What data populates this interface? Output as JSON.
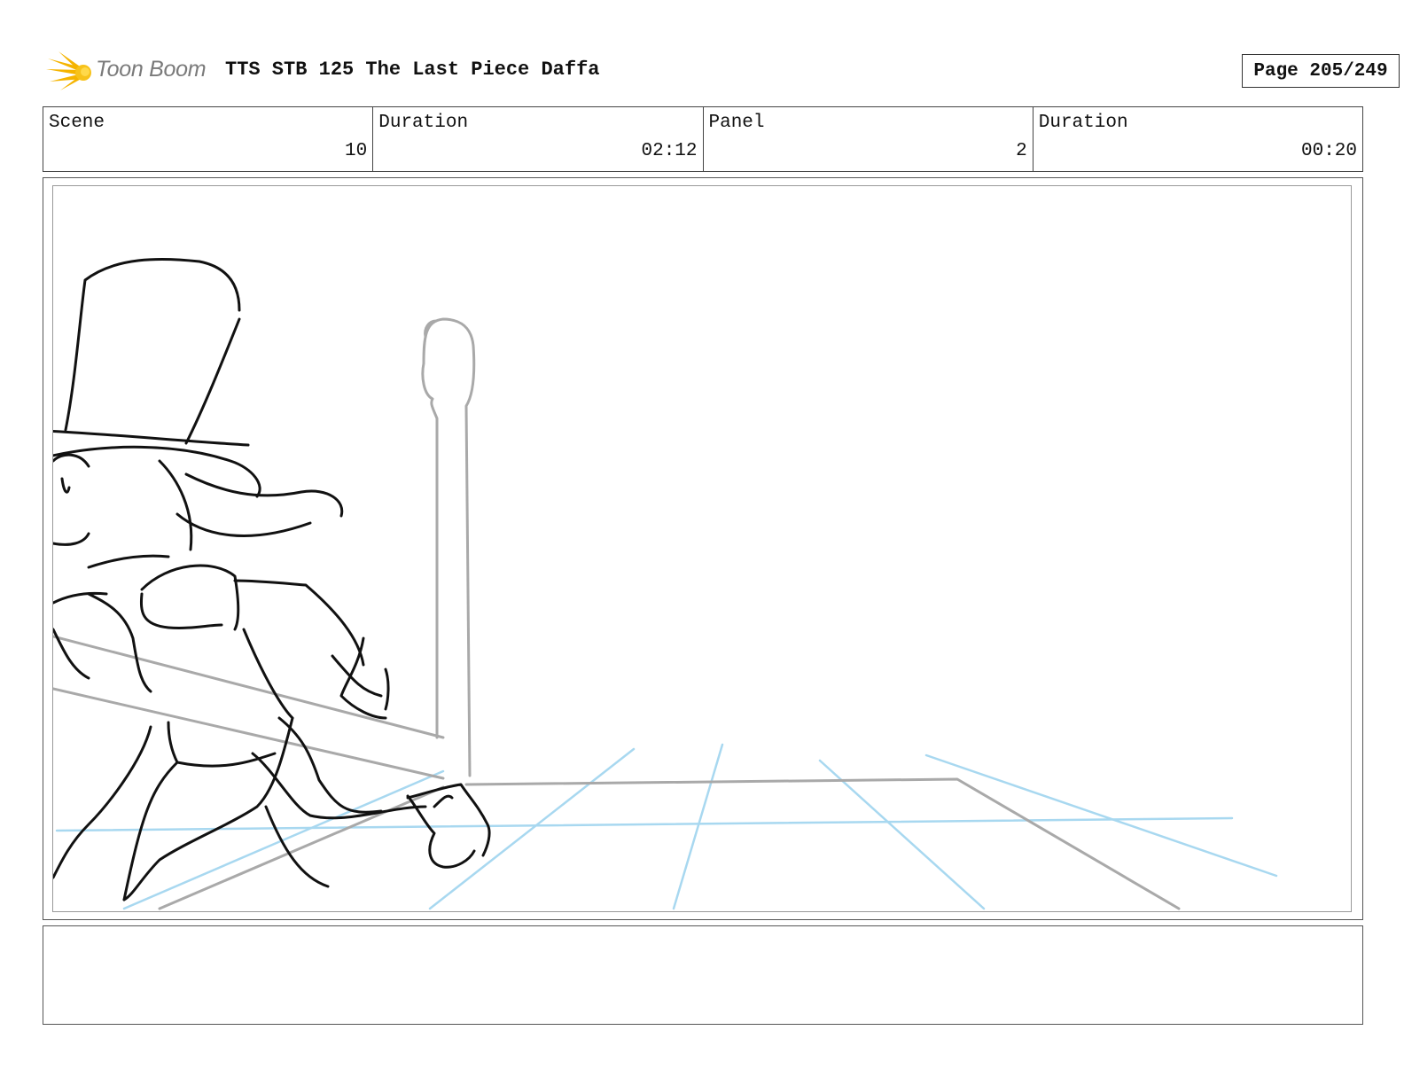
{
  "header": {
    "logo_text": "Toon Boom",
    "doc_title": "TTS STB 125 The Last Piece Daffa",
    "page_label": "Page 205/249"
  },
  "info": [
    {
      "label": "Scene",
      "value": "10"
    },
    {
      "label": "Duration",
      "value": "02:12"
    },
    {
      "label": "Panel",
      "value": "2"
    },
    {
      "label": "Duration",
      "value": "00:20"
    }
  ],
  "notes": {
    "text": ""
  },
  "colors": {
    "logo_star": "#f5b400",
    "sketch_ink": "#111111",
    "sketch_rough": "#a9a9a9",
    "sketch_guide": "#a8d8f0"
  }
}
